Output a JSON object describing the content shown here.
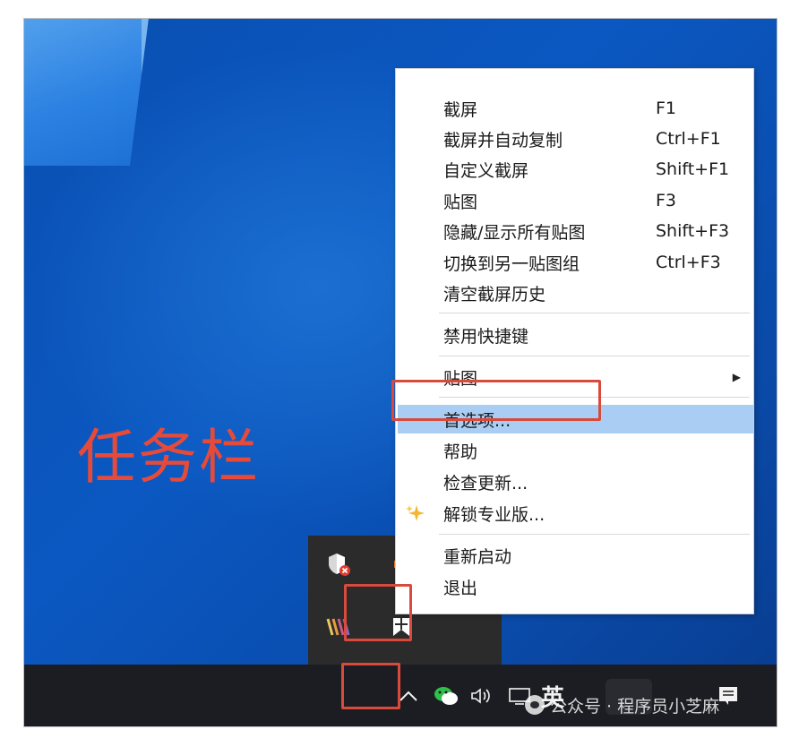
{
  "desktop": {
    "annotation_label": "任务栏"
  },
  "context_menu": {
    "items": [
      {
        "label": "截屏",
        "shortcut": "F1"
      },
      {
        "label": "截屏并自动复制",
        "shortcut": "Ctrl+F1"
      },
      {
        "label": "自定义截屏",
        "shortcut": "Shift+F1"
      },
      {
        "label": "贴图",
        "shortcut": "F3"
      },
      {
        "label": "隐藏/显示所有贴图",
        "shortcut": "Shift+F3"
      },
      {
        "label": "切换到另一贴图组",
        "shortcut": "Ctrl+F3"
      },
      {
        "label": "清空截屏历史",
        "shortcut": ""
      },
      {
        "label": "禁用快捷键",
        "shortcut": ""
      },
      {
        "label": "贴图",
        "shortcut": "",
        "submenu_arrow": "▶"
      },
      {
        "label": "首选项...",
        "shortcut": "",
        "highlighted": true
      },
      {
        "label": "帮助",
        "shortcut": ""
      },
      {
        "label": "检查更新...",
        "shortcut": ""
      },
      {
        "label": "解锁专业版...",
        "shortcut": "",
        "icon": "sparkle-icon"
      },
      {
        "label": "重新启动",
        "shortcut": ""
      },
      {
        "label": "退出",
        "shortcut": ""
      }
    ],
    "highlight_color": "#a9cdf3"
  },
  "tray_popup": {
    "icons": [
      "shield-warning-icon",
      "speaker-icon",
      "waves-app-icon",
      "snipaste-icon"
    ]
  },
  "taskbar": {
    "ime_label": "英",
    "icons": [
      "chevron-up-icon",
      "wechat-icon",
      "volume-icon",
      "network-icon",
      "notification-icon"
    ]
  },
  "watermark": {
    "text": "公众号 · 程序员小芝麻"
  },
  "colors": {
    "desktop_blue": "#0b58c2",
    "taskbar": "#1c1d22",
    "annotation_red": "#e84a3a"
  }
}
